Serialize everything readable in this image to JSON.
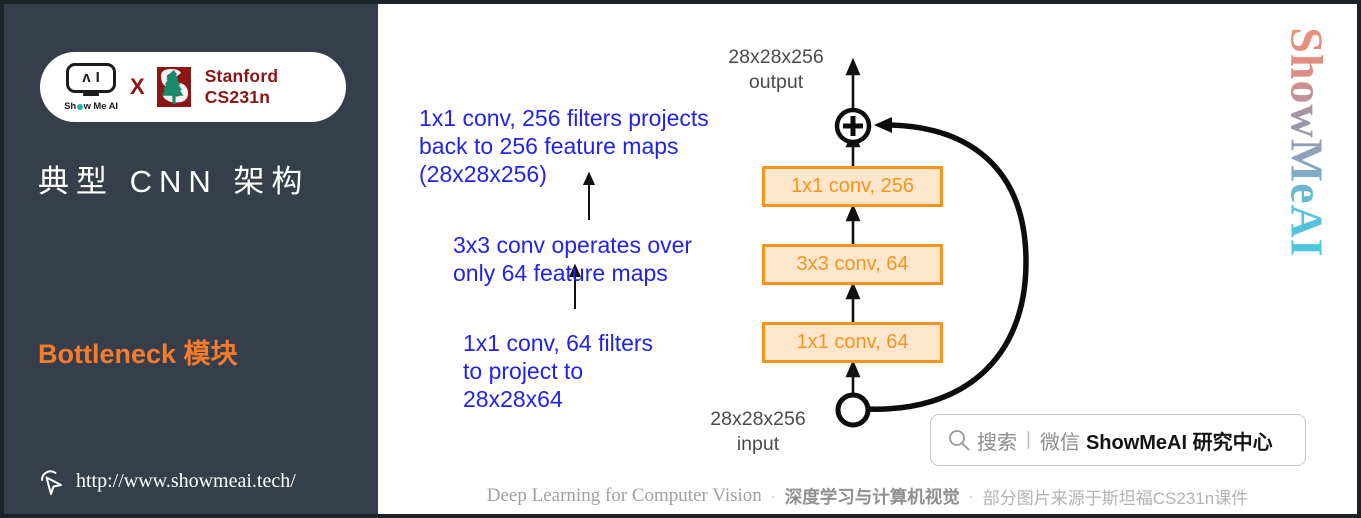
{
  "sidebar": {
    "logo": {
      "smai_icon": "robot-head-icon",
      "smai_glyph_left": "ʌ",
      "smai_glyph_right": "I",
      "smai_word_pre": "Sh",
      "smai_word_post": "w Me AI",
      "cross": "X",
      "stanford_icon": "stanford-tree-icon",
      "stanford_line1": "Stanford",
      "stanford_line2": "CS231n"
    },
    "title": "典型 CNN 架构",
    "subtitle": "Bottleneck 模块",
    "cursor_icon": "cursor-arrow-icon",
    "url": "http://www.showmeai.tech/",
    "bg_color": "#373e4b",
    "accent_color": "#f57c2b"
  },
  "diagram": {
    "notes": [
      "1x1 conv, 256 filters projects\nback to 256 feature maps\n(28x28x256)",
      "3x3 conv operates over\nonly 64 feature maps",
      "1x1 conv, 64 filters\nto project to\n28x28x64"
    ],
    "output_label": "28x28x256\noutput",
    "input_label": "28x28x256\ninput",
    "blocks": [
      {
        "label": "1x1 conv, 256"
      },
      {
        "label": "3x3 conv, 64"
      },
      {
        "label": "1x1 conv, 64"
      }
    ],
    "add_node_icon": "plus-circle-icon",
    "split_node_icon": "split-circle-icon",
    "skip_connection_icon": "skip-connection-curve",
    "note_color": "#2323e8",
    "block_fill": "#fde6cb",
    "block_stroke": "#f7941e"
  },
  "search": {
    "icon": "search-icon",
    "placeholder": "搜索",
    "divider": "|",
    "channel": "微信",
    "brand": "ShowMeAI 研究中心"
  },
  "footer": {
    "english": "Deep Learning for Computer Vision",
    "sep1": "·",
    "chinese_bold": "深度学习与计算机视觉",
    "sep2": "·",
    "chinese_note": "部分图片来源于斯坦福CS231n课件"
  },
  "watermark": {
    "text": "ShowMeAI"
  }
}
